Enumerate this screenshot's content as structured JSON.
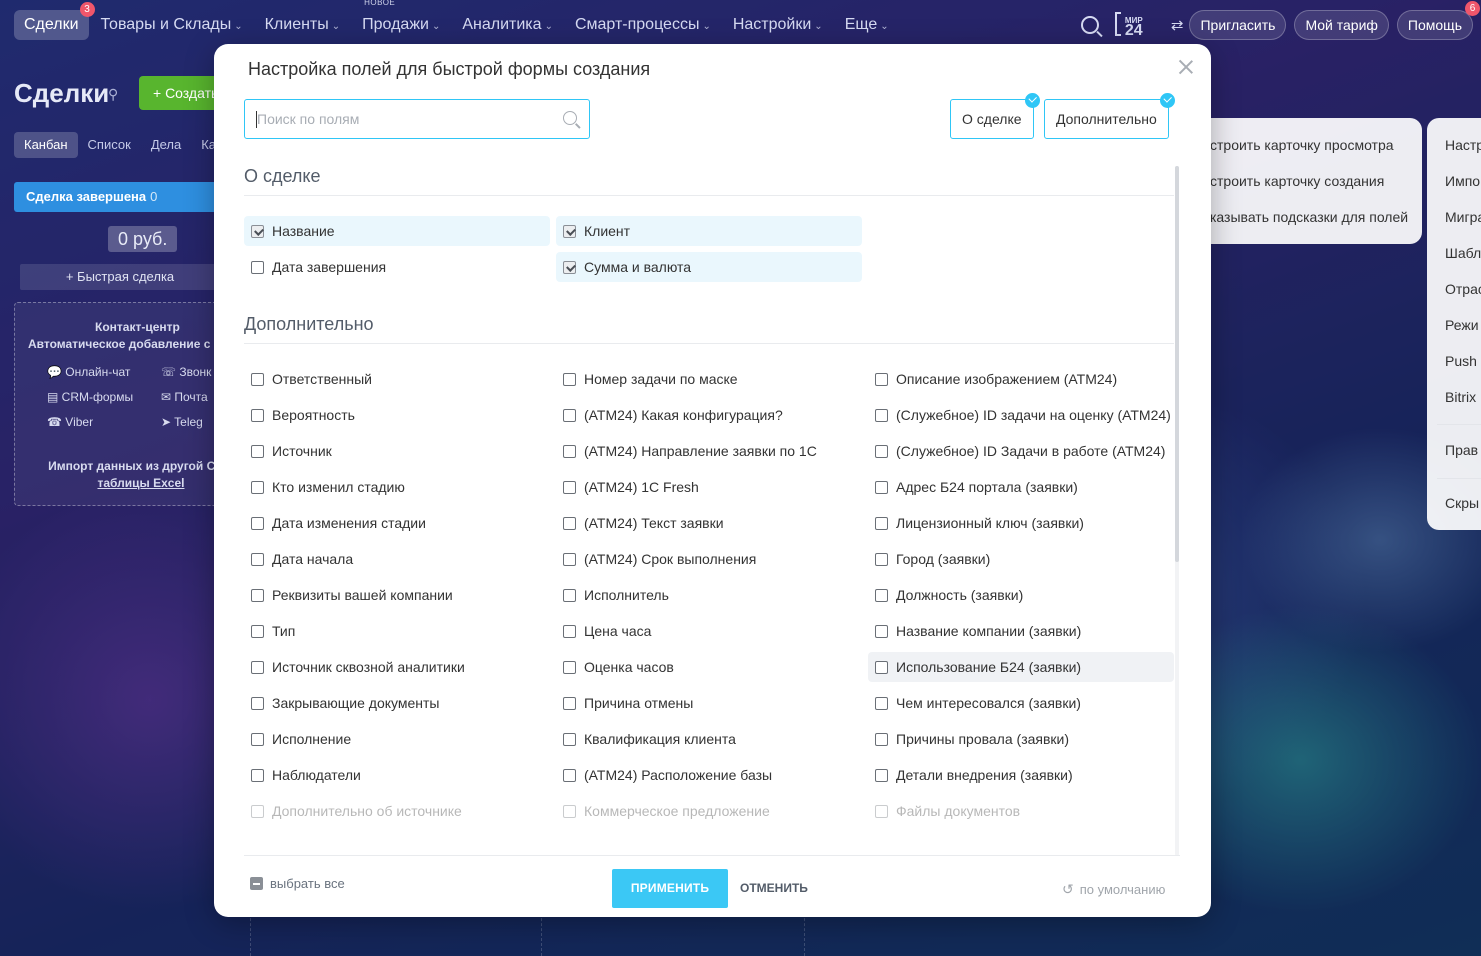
{
  "nav": {
    "items": [
      {
        "label": "Сделки",
        "badge": "3",
        "active": true
      },
      {
        "label": "Товары и Склады",
        "chevron": true
      },
      {
        "label": "Клиенты",
        "chevron": true
      },
      {
        "label": "Продажи",
        "chevron": true,
        "tag": "НОВОЕ"
      },
      {
        "label": "Аналитика",
        "chevron": true
      },
      {
        "label": "Смарт-процессы",
        "chevron": true
      },
      {
        "label": "Настройки",
        "chevron": true
      },
      {
        "label": "Еще",
        "chevron": true
      }
    ],
    "logo_top": "МИР",
    "logo_bottom": "24",
    "invite_label": "Пригласить",
    "tariff_label": "Мой тариф",
    "help_label": "Помощь",
    "help_badge": "6"
  },
  "page": {
    "title": "Сделки",
    "create_label": "+ Создать",
    "view_tabs": [
      "Канбан",
      "Список",
      "Дела",
      "Ка"
    ],
    "column_title": "Сделка завершена",
    "column_count": "0",
    "column_sum": "0 руб.",
    "quick_deal": "+ Быстрая сделка",
    "contact_center": {
      "title": "Контакт-центр",
      "subtitle": "Автоматическое добавление с",
      "items": [
        "Онлайн-чат",
        "Звонк",
        "CRM-формы",
        "Почта",
        "Viber",
        "Teleg"
      ],
      "import_line1": "Импорт данных из другой CRM",
      "import_line2": "таблицы Excel"
    }
  },
  "side_menu_1": [
    "строить карточку просмотра",
    "строить карточку создания",
    "казывать подсказки для полей"
  ],
  "side_menu_2": [
    "Настр",
    "Импо",
    "Мигра",
    "Шабл",
    "Отрас",
    "Режи",
    "Push C",
    "Bitrix",
    "Прав",
    "Скры"
  ],
  "modal": {
    "title": "Настройка полей для быстрой формы создания",
    "search_placeholder": "Поиск по полям",
    "filter_buttons": [
      "О сделке",
      "Дополнительно"
    ],
    "sections": [
      {
        "title": "О сделке",
        "fields": [
          {
            "label": "Название",
            "checked": true
          },
          {
            "label": "Клиент",
            "checked": true
          },
          {
            "label": "Дата завершения",
            "checked": false
          },
          {
            "label": "Сумма и валюта",
            "checked": true
          }
        ]
      },
      {
        "title": "Дополнительно",
        "fields": [
          {
            "label": "Ответственный",
            "checked": false
          },
          {
            "label": "Номер задачи по маске",
            "checked": false
          },
          {
            "label": "Описание изображением (АТМ24)",
            "checked": false
          },
          {
            "label": "Вероятность",
            "checked": false
          },
          {
            "label": "(АТМ24) Какая конфигурация?",
            "checked": false
          },
          {
            "label": "(Служебное) ID задачи на оценку (АТМ24)",
            "checked": false
          },
          {
            "label": "Источник",
            "checked": false
          },
          {
            "label": "(АТМ24) Направление заявки по 1С",
            "checked": false
          },
          {
            "label": "(Служебное) ID Задачи в работе (АТМ24)",
            "checked": false
          },
          {
            "label": "Кто изменил стадию",
            "checked": false
          },
          {
            "label": "(АТМ24) 1С Fresh",
            "checked": false
          },
          {
            "label": "Адрес Б24 портала (заявки)",
            "checked": false
          },
          {
            "label": "Дата изменения стадии",
            "checked": false
          },
          {
            "label": "(АТМ24) Текст заявки",
            "checked": false
          },
          {
            "label": "Лицензионный ключ (заявки)",
            "checked": false
          },
          {
            "label": "Дата начала",
            "checked": false
          },
          {
            "label": "(АТМ24) Срок выполнения",
            "checked": false
          },
          {
            "label": "Город (заявки)",
            "checked": false
          },
          {
            "label": "Реквизиты вашей компании",
            "checked": false
          },
          {
            "label": "Исполнитель",
            "checked": false
          },
          {
            "label": "Должность (заявки)",
            "checked": false
          },
          {
            "label": "Тип",
            "checked": false
          },
          {
            "label": "Цена часа",
            "checked": false
          },
          {
            "label": "Название компании (заявки)",
            "checked": false
          },
          {
            "label": "Источник сквозной аналитики",
            "checked": false
          },
          {
            "label": "Оценка часов",
            "checked": false
          },
          {
            "label": "Использование Б24 (заявки)",
            "checked": false,
            "hover": true
          },
          {
            "label": "Закрывающие документы",
            "checked": false
          },
          {
            "label": "Причина отмены",
            "checked": false
          },
          {
            "label": "Чем интересовался (заявки)",
            "checked": false
          },
          {
            "label": "Исполнение",
            "checked": false
          },
          {
            "label": "Квалификация клиента",
            "checked": false
          },
          {
            "label": "Причины провала (заявки)",
            "checked": false
          },
          {
            "label": "Наблюдатели",
            "checked": false
          },
          {
            "label": "(АТМ24) Расположение базы",
            "checked": false
          },
          {
            "label": "Детали внедрения (заявки)",
            "checked": false
          },
          {
            "label": "Дополнительно об источнике",
            "checked": false
          },
          {
            "label": "Коммерческое предложение",
            "checked": false
          },
          {
            "label": "Файлы документов",
            "checked": false
          }
        ]
      }
    ],
    "footer": {
      "select_all": "выбрать все",
      "apply": "ПРИМЕНИТЬ",
      "cancel": "ОТМЕНИТЬ",
      "default": "по умолчанию"
    }
  },
  "colors": {
    "accent": "#3bc8f5",
    "border_accent": "#2fc6f6",
    "selected_bg": "#eaf7fd",
    "create_green": "#58b52e",
    "column_blue": "#2e8fe0"
  }
}
